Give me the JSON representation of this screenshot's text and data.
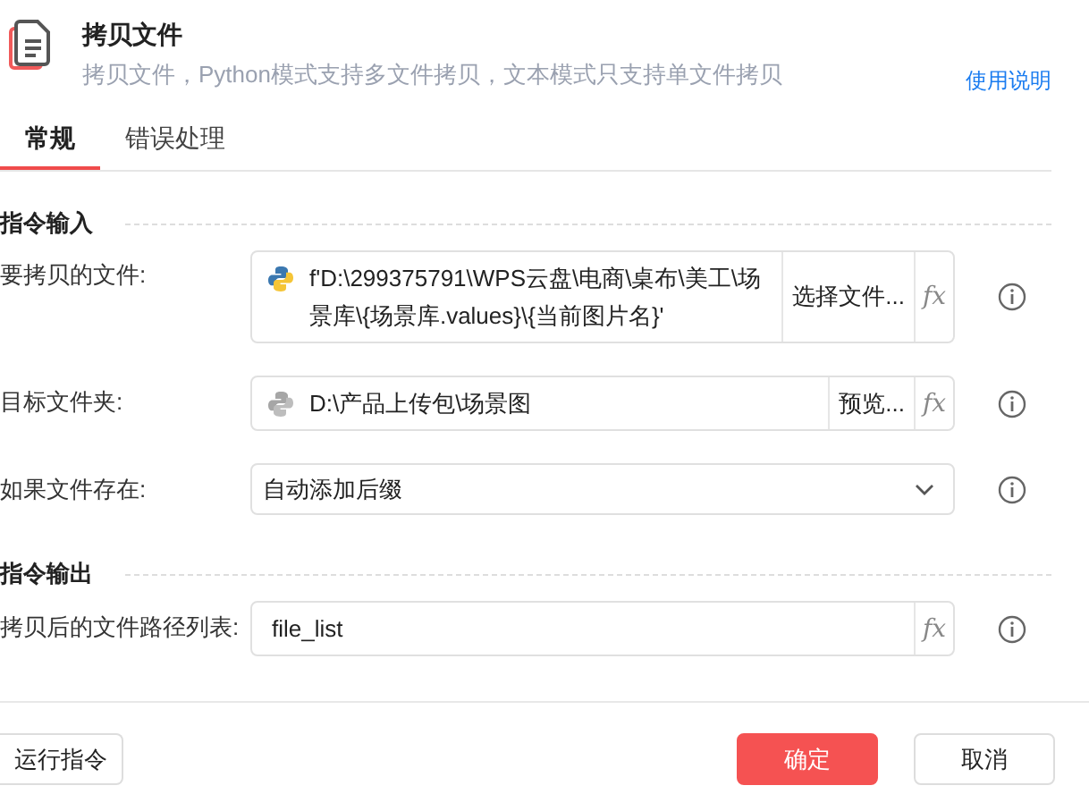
{
  "header": {
    "title": "拷贝文件",
    "description": "拷贝文件，Python模式支持多文件拷贝，文本模式只支持单文件拷贝",
    "help_link": "使用说明"
  },
  "tabs": [
    {
      "label": "常规",
      "selected": true
    },
    {
      "label": "错误处理",
      "selected": false
    }
  ],
  "sections": [
    {
      "title": "指令输入",
      "rows": [
        {
          "kind": "path",
          "label": "要拷贝的文件:",
          "python_active": true,
          "value": "f'D:\\299375791\\WPS云盘\\电商\\桌布\\美工\\场景库\\{场景库.values}\\{当前图片名}'",
          "button": "选择文件...",
          "fx": "fx"
        },
        {
          "kind": "path",
          "label": "目标文件夹:",
          "python_active": false,
          "value": "D:\\产品上传包\\场景图",
          "button": "预览...",
          "fx": "fx"
        },
        {
          "kind": "select",
          "label": "如果文件存在:",
          "value": "自动添加后缀"
        }
      ]
    },
    {
      "title": "指令输出",
      "rows": [
        {
          "kind": "variable",
          "label": "拷贝后的文件路径列表:",
          "value": "file_list",
          "fx": "fx"
        }
      ]
    }
  ],
  "footer": {
    "run_button": "运行指令",
    "ok_button": "确定",
    "cancel_button": "取消"
  }
}
